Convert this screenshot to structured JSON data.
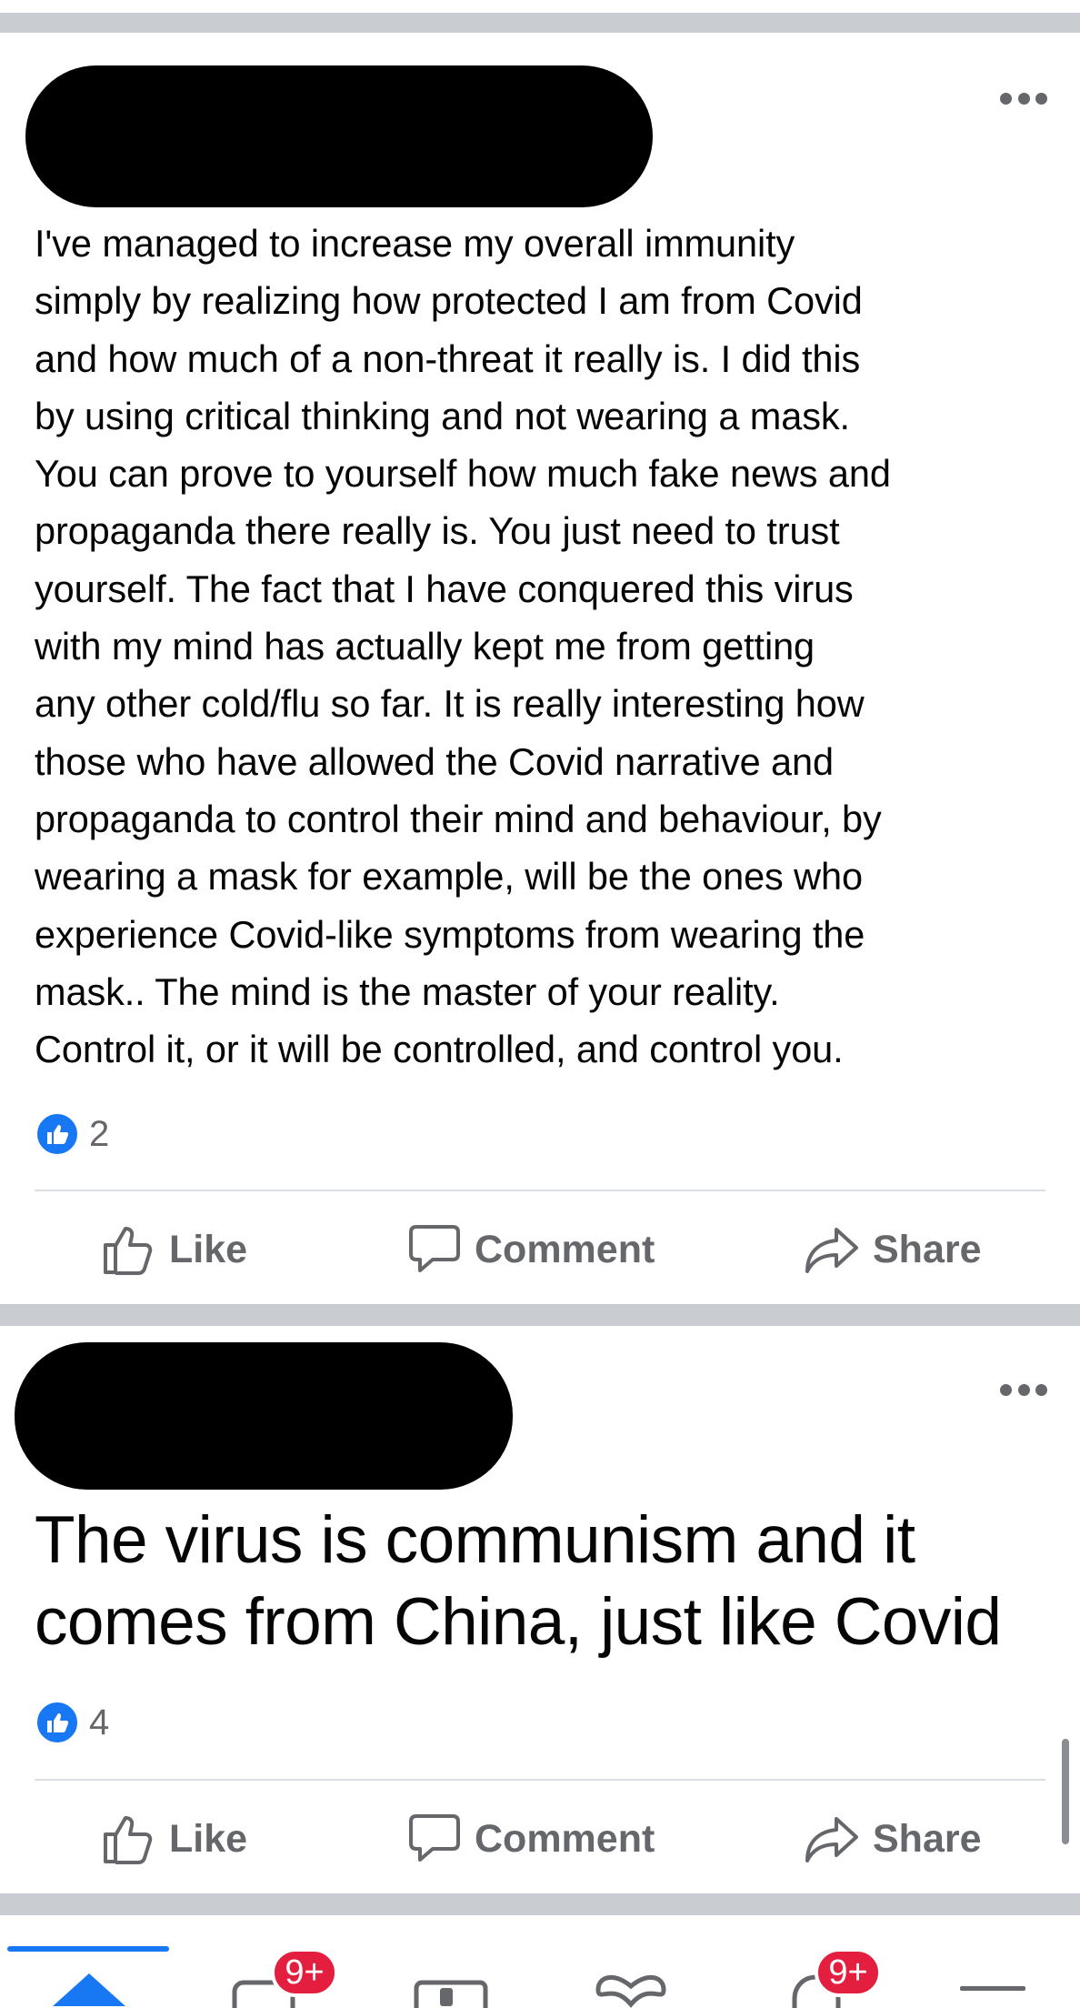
{
  "posts": [
    {
      "text": "I've managed to increase my overall immunity\nsimply by realizing how protected I am from Covid\nand how much of a non-threat it really is. I did this\nby using critical thinking and not wearing a mask.\nYou can prove to yourself how much fake news and\npropaganda there really is. You just need to trust\nyourself. The fact that I have conquered this virus\nwith my mind has actually kept me from getting\nany other cold/flu so far. It is really interesting how\nthose who have allowed the Covid narrative and\npropaganda to control their mind and behaviour, by\nwearing a mask for example, will be the ones who\nexperience Covid-like symptoms from wearing the\nmask.. The mind is the master of your reality.\nControl it, or it will be controlled, and control you.",
      "reaction_count": "2",
      "actions": {
        "like": "Like",
        "comment": "Comment",
        "share": "Share"
      }
    },
    {
      "text": "The virus is communism and it\ncomes from China, just like Covid",
      "reaction_count": "4",
      "actions": {
        "like": "Like",
        "comment": "Comment",
        "share": "Share"
      }
    }
  ],
  "bottom_nav": {
    "items": [
      {
        "icon": "home-icon"
      },
      {
        "icon": "watch-icon",
        "badge": "9+"
      },
      {
        "icon": "marketplace-icon"
      },
      {
        "icon": "dating-icon"
      },
      {
        "icon": "notifications-icon",
        "badge": "9+"
      },
      {
        "icon": "menu-icon"
      }
    ]
  },
  "colors": {
    "brand_blue": "#1877f2",
    "badge_red": "#e41e3f",
    "secondary_text": "#65676b",
    "feed_divider": "#c9ccd1"
  }
}
